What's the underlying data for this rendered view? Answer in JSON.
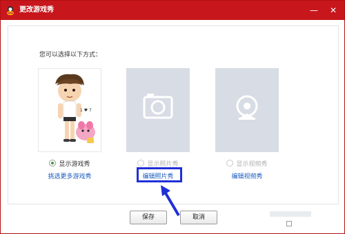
{
  "window": {
    "title": "更改游戏秀"
  },
  "main": {
    "prompt": "您可以选择以下方式："
  },
  "options": [
    {
      "radio_label": "显示游戏秀",
      "link_label": "挑选更多游戏秀",
      "selected": true,
      "enabled": true
    },
    {
      "radio_label": "显示照片秀",
      "link_label": "编辑照片秀",
      "selected": false,
      "enabled": false
    },
    {
      "radio_label": "显示视频秀",
      "link_label": "编辑视频秀",
      "selected": false,
      "enabled": false
    }
  ],
  "footer": {
    "save_label": "保存",
    "cancel_label": "取消"
  },
  "icons": {
    "close": "close-icon",
    "minimize": "minimize-icon",
    "camera": "camera-icon",
    "webcam": "webcam-icon"
  },
  "colors": {
    "titlebar": "#c8161d",
    "link": "#1a5bbf",
    "highlight": "#1f2fd8"
  }
}
